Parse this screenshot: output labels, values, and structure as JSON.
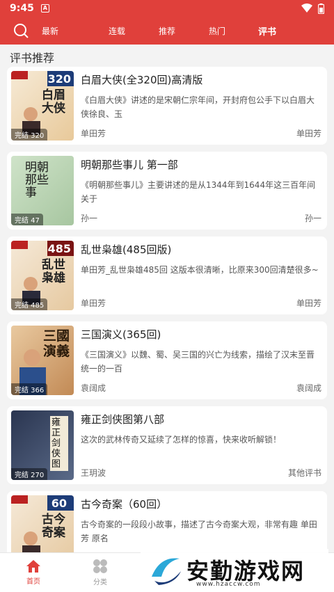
{
  "status_bar": {
    "time": "9:45",
    "a_icon_letter": "A"
  },
  "top_nav": {
    "tabs": [
      {
        "label": "最新"
      },
      {
        "label": "连载"
      },
      {
        "label": "推荐"
      },
      {
        "label": "热门"
      },
      {
        "label": "评书"
      }
    ],
    "active_tab": "评书"
  },
  "section_title": "评书推荐",
  "items": [
    {
      "title": "白眉大侠(全320回)高清版",
      "desc": "《白眉大侠》讲述的是宋朝仁宗年间，开封府包公手下以白眉大侠徐良、玉",
      "narrator": "单田芳",
      "category": "单田芳",
      "badge": "完结 320",
      "cover_text": "白眉大侠",
      "cover_num": "320"
    },
    {
      "title": "明朝那些事儿 第一部",
      "desc": "《明朝那些事儿》主要讲述的是从1344年到1644年这三百年间关于",
      "narrator": "孙一",
      "category": "孙一",
      "badge": "完结 47",
      "cover_text": "明朝那些事",
      "cover_num": ""
    },
    {
      "title": "乱世枭雄(485回版)",
      "desc": "单田芳_乱世枭雄485回 这版本很清晰，比原来300回清楚很多~",
      "narrator": "单田芳",
      "category": "单田芳",
      "badge": "完结 485",
      "cover_text": "乱世枭雄",
      "cover_num": "485"
    },
    {
      "title": "三国演义(365回)",
      "desc": "《三国演义》以魏、蜀、吴三国的兴亡为线索，描绘了汉末至晋统一的一百",
      "narrator": "袁阔成",
      "category": "袁阔成",
      "badge": "完结 366",
      "cover_text": "三國演義",
      "cover_num": ""
    },
    {
      "title": "雍正剑侠图第八部",
      "desc": "这次的武林传奇又延续了怎样的惊喜，快来收听解锁！",
      "narrator": "王玥波",
      "category": "其他评书",
      "badge": "完结 270",
      "cover_text": "雍正剑侠图",
      "cover_num": ""
    },
    {
      "title": "古今奇案（60回）",
      "desc": "古今奇案的一段段小故事，描述了古今奇案大观，非常有趣 单田芳 原名",
      "narrator": "",
      "category": "",
      "badge": "",
      "cover_text": "古今奇案",
      "cover_num": "60"
    }
  ],
  "bottom_nav": [
    {
      "label": "首页",
      "icon": "home-icon"
    },
    {
      "label": "分类",
      "icon": "grid-icon"
    }
  ],
  "watermark": {
    "text": "安勤游戏网",
    "url": "www.hzaccw.com"
  },
  "colors": {
    "accent": "#e0403b"
  }
}
